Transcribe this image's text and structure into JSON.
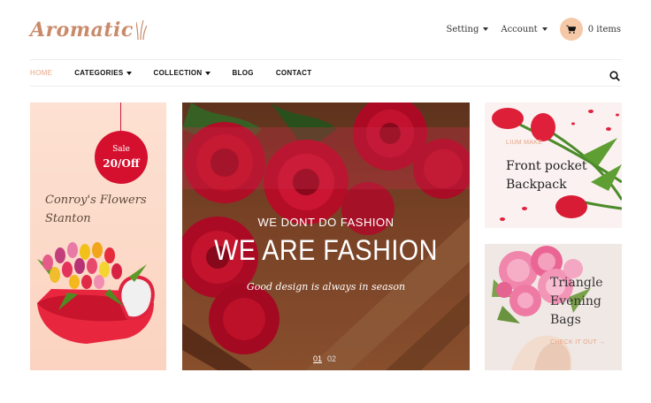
{
  "brand": {
    "logo_text": "Aromatic"
  },
  "header": {
    "setting_label": "Setting",
    "account_label": "Account",
    "cart_count": "0 items"
  },
  "nav": {
    "items": [
      {
        "label": "HOME",
        "active": true,
        "dropdown": false
      },
      {
        "label": "CATEGORIES",
        "active": false,
        "dropdown": true
      },
      {
        "label": "COLLECTION",
        "active": false,
        "dropdown": true
      },
      {
        "label": "BLOG",
        "active": false,
        "dropdown": false
      },
      {
        "label": "CONTACT",
        "active": false,
        "dropdown": false
      }
    ]
  },
  "left_promo": {
    "sale_label": "Sale",
    "sale_value": "20/Off",
    "title_line1": "Conroy's Flowers",
    "title_line2": "Stanton"
  },
  "hero": {
    "subtitle": "WE DONT DO FASHION",
    "title": "WE ARE FASHION",
    "tagline": "Good design is always in season",
    "slides": [
      "01",
      "02"
    ],
    "active_slide": "01"
  },
  "card1": {
    "eyebrow": "LIUM MAKE",
    "title_line1": "Front pocket",
    "title_line2": "Backpack"
  },
  "card2": {
    "title_line1": "Triangle",
    "title_line2": "Evening",
    "title_line3": "Bags",
    "link": "CHECK IT OUT →"
  },
  "colors": {
    "accent": "#e7a585",
    "sale_red": "#d5102f",
    "cart_bg": "#f5c9a8"
  },
  "icons": [
    "logo-grass-icon",
    "cart-icon",
    "search-icon",
    "caret-down-icon"
  ]
}
